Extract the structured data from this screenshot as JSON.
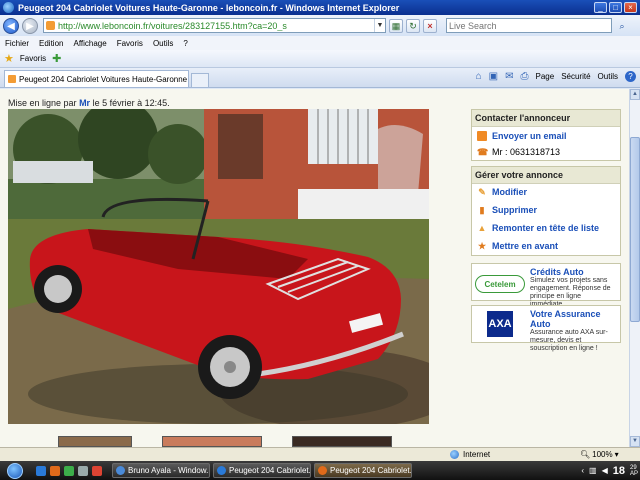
{
  "window": {
    "title": "Peugeot 204 Cabriolet Voitures Haute-Garonne - leboncoin.fr - Windows Internet Explorer",
    "min": "_",
    "max": "□",
    "close": "×"
  },
  "address": {
    "url": "http://www.leboncoin.fr/voitures/283127155.htm?ca=20_s",
    "search_placeholder": "Live Search"
  },
  "menu": [
    "Fichier",
    "Edition",
    "Affichage",
    "Favoris",
    "Outils",
    "?"
  ],
  "favorites": {
    "label": "Favoris"
  },
  "tab": {
    "title": "Peugeot 204 Cabriolet Voitures Haute-Garonne - lebo..."
  },
  "commands": {
    "page": "Page",
    "security": "Sécurité",
    "tools": "Outils"
  },
  "listing": {
    "posted_prefix": "Mise en ligne par",
    "author": "Mr",
    "posted_suffix": "le 5 février à 12:45."
  },
  "contact": {
    "title": "Contacter l'annonceur",
    "email": "Envoyer un email",
    "phone": "Mr : 0631318713"
  },
  "manage": {
    "title": "Gérer votre annonce",
    "modify": "Modifier",
    "delete": "Supprimer",
    "bump": "Remonter en tête de liste",
    "feature": "Mettre en avant"
  },
  "ads": [
    {
      "logo": "Cetelem",
      "title": "Crédits Auto",
      "text": "Simulez vos projets sans engagement. Réponse de principe en ligne immédiate."
    },
    {
      "logo": "AXA",
      "title": "Votre Assurance Auto",
      "text": "Assurance auto AXA sur-mesure, devis et souscription en ligne !"
    }
  ],
  "status": {
    "zone": "Internet",
    "zoom": "100%"
  },
  "taskbar": {
    "tasks": [
      "Bruno Ayala - Window...",
      "Peugeot 204 Cabriolet...",
      "Peugeot 204 Cabriolet..."
    ],
    "clock": "18",
    "clock_small_1": "29",
    "clock_small_2": "AP"
  },
  "colors": {
    "link": "#1a4fb8",
    "car": "#c8151b",
    "titlebar": "#0a2f8f"
  }
}
